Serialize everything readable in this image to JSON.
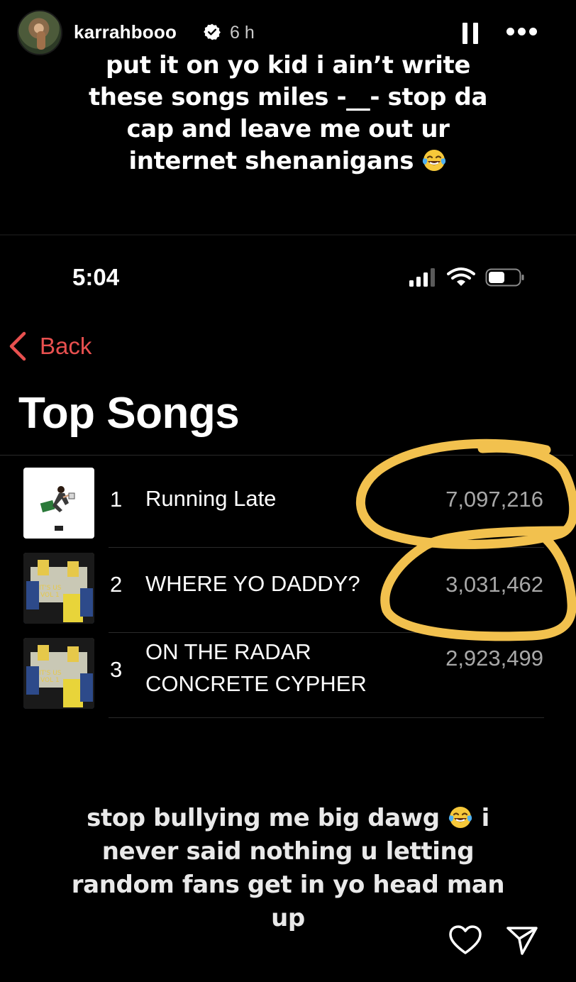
{
  "story": {
    "username": "karrahbooo",
    "time_ago": "6 h",
    "caption_top_lines": [
      "put it on yo kid i ain’t write",
      "these songs miles -__- stop da",
      "cap and leave me out ur",
      "internet shenanigans"
    ],
    "caption_bottom_lines": [
      "stop bullying me big dawg",
      "i",
      "never said nothing  u letting",
      "random fans get in yo head man",
      "up"
    ]
  },
  "screenshot": {
    "status_time": "5:04",
    "back_label": "Back",
    "title": "Top Songs",
    "songs": [
      {
        "rank": "1",
        "title_lines": [
          "Running Late"
        ],
        "plays": "7,097,216"
      },
      {
        "rank": "2",
        "title_lines": [
          "WHERE YO DADDY?"
        ],
        "plays": "3,031,462"
      },
      {
        "rank": "3",
        "title_lines": [
          "ON THE RADAR",
          "CONCRETE CYPHER"
        ],
        "plays": "2,923,499"
      }
    ]
  },
  "colors": {
    "accent_back": "#e8504f",
    "highlight_marker": "#f2c14e",
    "play_count": "#a8a8a8",
    "verified_badge": "#ffffff"
  },
  "icons": {
    "verified": "verified-badge-icon",
    "pause": "pause-icon",
    "more": "more-horizontal-icon",
    "signal": "cellular-signal-icon",
    "wifi": "wifi-icon",
    "battery": "battery-icon",
    "back": "chevron-left-icon",
    "emoji": "laughing-tears-emoji",
    "like": "heart-icon",
    "share": "send-icon"
  }
}
